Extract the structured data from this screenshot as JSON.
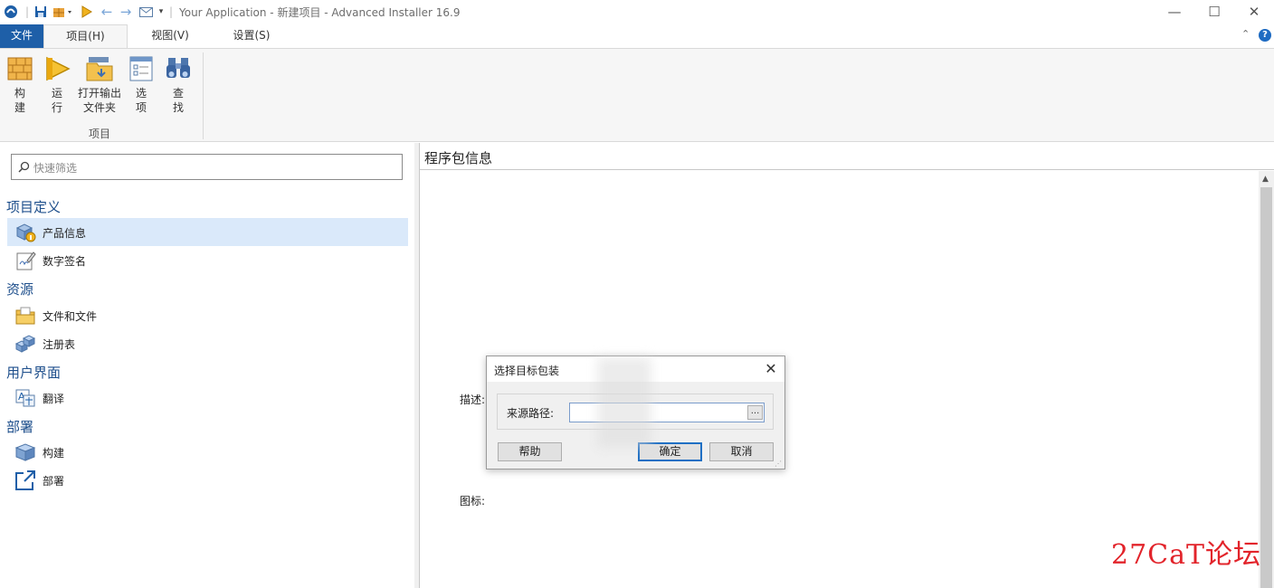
{
  "window": {
    "title": "Your Application - 新建项目 - Advanced Installer 16.9",
    "minimize": "—",
    "maximize": "☐",
    "close": "✕"
  },
  "quick_access": [
    "app-logo-icon",
    "save-icon",
    "build-icon",
    "run-icon",
    "back-icon",
    "forward-icon",
    "mail-icon",
    "customize-icon"
  ],
  "tabs": [
    {
      "label": "文件"
    },
    {
      "label": "项目(H)"
    },
    {
      "label": "视图(V)"
    },
    {
      "label": "设置(S)"
    }
  ],
  "ribbon": {
    "collapse": "⌃",
    "help": "?",
    "group_label": "项目",
    "buttons": [
      {
        "label": "构\n建",
        "icon": "build-bricks-icon"
      },
      {
        "label": "运\n行",
        "icon": "run-icon"
      },
      {
        "label": "打开输出\n文件夹",
        "icon": "open-folder-icon"
      },
      {
        "label": "选\n项",
        "icon": "options-icon"
      },
      {
        "label": "查\n找",
        "icon": "binoculars-icon"
      }
    ]
  },
  "search": {
    "placeholder": "快速筛选"
  },
  "nav": {
    "sections": [
      {
        "title": "项目定义",
        "items": [
          {
            "label": "产品信息",
            "icon": "product-info-icon",
            "selected": true
          },
          {
            "label": "数字签名",
            "icon": "digital-signature-icon"
          }
        ]
      },
      {
        "title": "资源",
        "items": [
          {
            "label": "文件和文件",
            "icon": "files-folder-icon"
          },
          {
            "label": "注册表",
            "icon": "registry-icon"
          }
        ]
      },
      {
        "title": "用户界面",
        "items": [
          {
            "label": "翻译",
            "icon": "translation-icon"
          }
        ]
      },
      {
        "title": "部署",
        "items": [
          {
            "label": "构建",
            "icon": "build-box-icon"
          },
          {
            "label": "部署",
            "icon": "deploy-icon"
          }
        ]
      }
    ]
  },
  "content": {
    "title": "程序包信息",
    "desc_label": "描述:",
    "icon_label": "图标:"
  },
  "dialog": {
    "title": "选择目标包装",
    "source_label": "来源路径:",
    "source_value": "",
    "browse": "...",
    "help_btn": "帮助",
    "ok_btn": "确定",
    "cancel_btn": "取消"
  },
  "watermark": "27CaT论坛",
  "colors": {
    "file_tab": "#1e5fa8",
    "section": "#1e4f8c",
    "selected": "#dae9fa"
  }
}
